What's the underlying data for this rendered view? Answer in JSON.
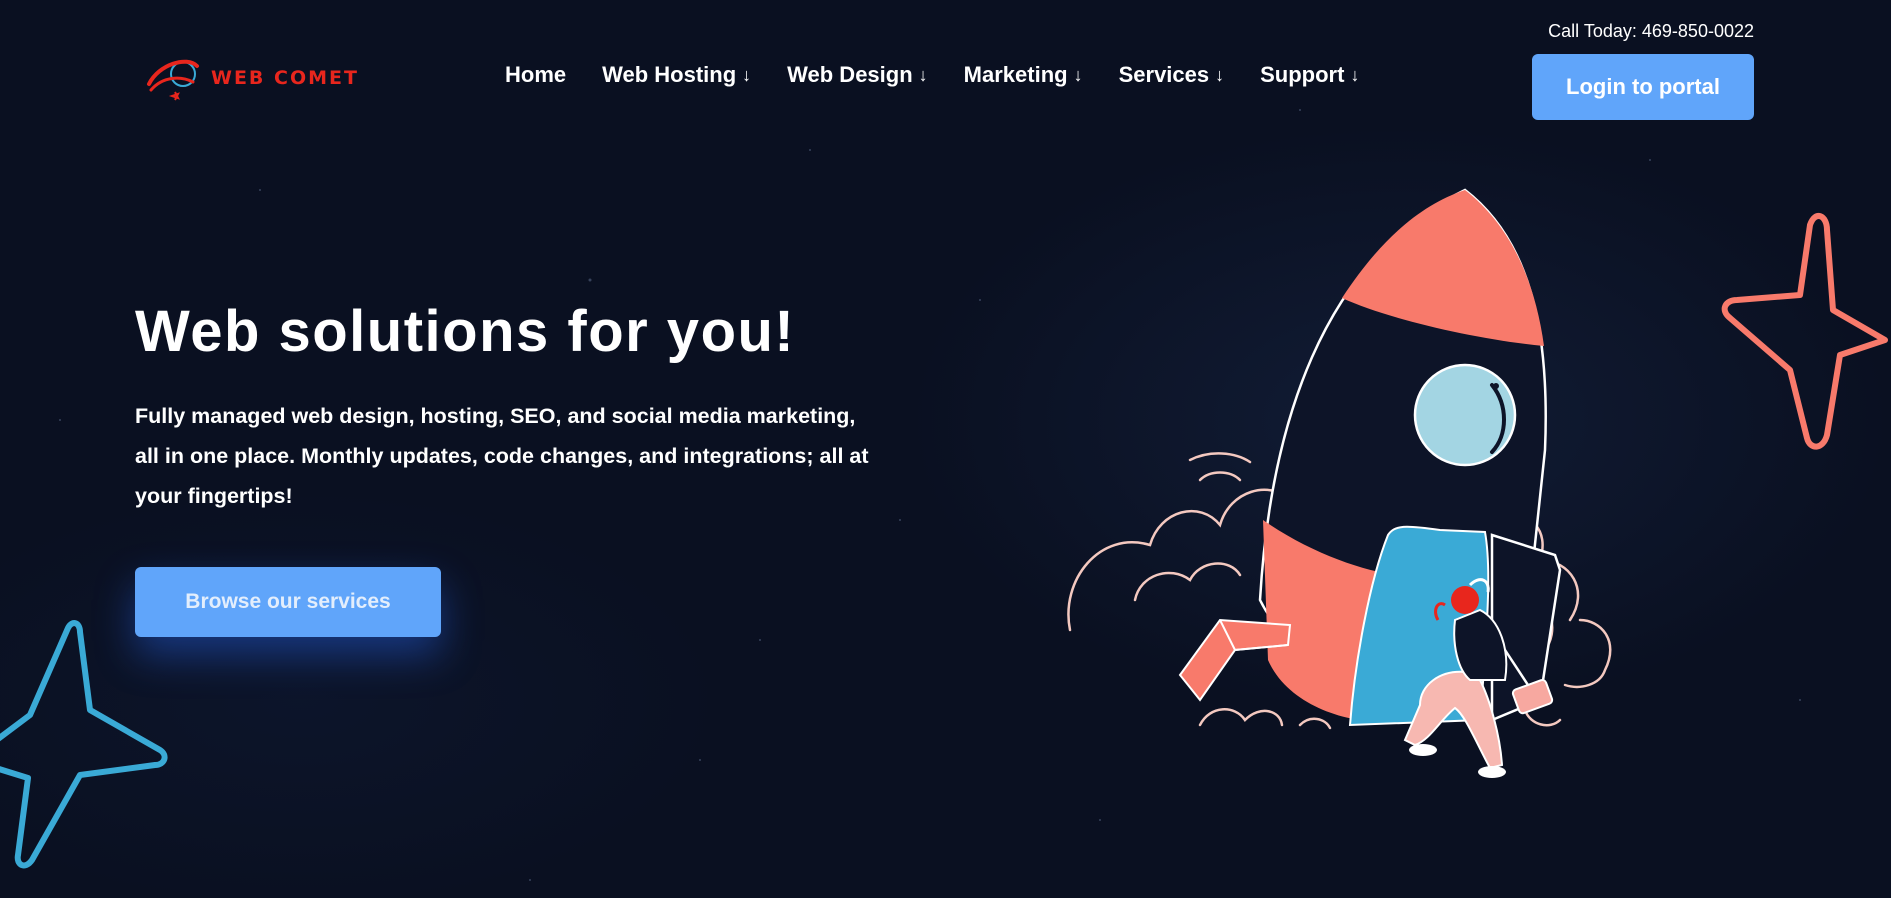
{
  "brand": {
    "name": "WEB COMET",
    "color": "#e8261d"
  },
  "nav": {
    "items": [
      {
        "label": "Home",
        "has_dropdown": false
      },
      {
        "label": "Web Hosting",
        "has_dropdown": true
      },
      {
        "label": "Web Design",
        "has_dropdown": true
      },
      {
        "label": "Marketing",
        "has_dropdown": true
      },
      {
        "label": "Services",
        "has_dropdown": true
      },
      {
        "label": "Support",
        "has_dropdown": true
      }
    ],
    "dropdown_glyph": "↓"
  },
  "header": {
    "phone": "Call Today: 469-850-0022",
    "login_label": "Login to portal"
  },
  "hero": {
    "title": "Web solutions for you!",
    "description": "Fully managed web design, hosting, SEO, and social media marketing, all in one place. Monthly updates, code changes, and integrations; all at your fingertips!",
    "cta_label": "Browse our services"
  },
  "colors": {
    "background": "#0a1021",
    "accent_blue": "#60a5fa",
    "coral": "#f87a6b",
    "sky": "#3aaad6"
  },
  "icons": [
    "comet-logo-icon",
    "chevron-down-icon",
    "rocket-illustration",
    "star-outline-icon"
  ]
}
